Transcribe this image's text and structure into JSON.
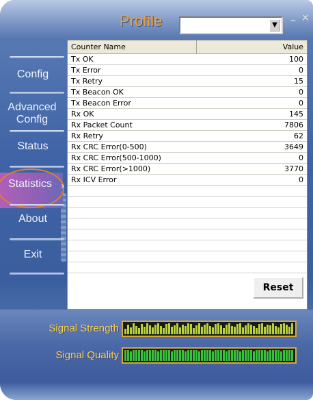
{
  "header": {
    "title": "Profile",
    "profile_value": "",
    "minimize_glyph": "–",
    "close_glyph": "×"
  },
  "sidebar": {
    "items": [
      {
        "label": "Config"
      },
      {
        "label": "Advanced Config"
      },
      {
        "label": "Status"
      },
      {
        "label": "Statistics",
        "active": true
      },
      {
        "label": "About"
      },
      {
        "label": "Exit"
      }
    ]
  },
  "statistics": {
    "columns": [
      "Counter Name",
      "Value"
    ],
    "rows": [
      {
        "name": "Tx OK",
        "value": "100"
      },
      {
        "name": "Tx Error",
        "value": "0"
      },
      {
        "name": "Tx Retry",
        "value": "15"
      },
      {
        "name": "Tx Beacon OK",
        "value": "0"
      },
      {
        "name": "Tx Beacon Error",
        "value": "0"
      },
      {
        "name": "Rx OK",
        "value": "145"
      },
      {
        "name": "Rx Packet Count",
        "value": "7806"
      },
      {
        "name": "Rx Retry",
        "value": "62"
      },
      {
        "name": "Rx CRC Error(0-500)",
        "value": "3649"
      },
      {
        "name": "Rx CRC Error(500-1000)",
        "value": "0"
      },
      {
        "name": "Rx CRC Error(>1000)",
        "value": "3770"
      },
      {
        "name": "Rx ICV Error",
        "value": "0"
      }
    ],
    "reset_label": "Reset"
  },
  "meters": {
    "signal_strength_label": "Signal Strength",
    "signal_quality_label": "Signal Quality"
  },
  "colors": {
    "accent_orange": "#f0a030",
    "label_yellow": "#ffd24a",
    "strength_bar": "#b7d23a",
    "quality_bar": "#36c23b",
    "highlight_ring": "#e87c2a"
  }
}
